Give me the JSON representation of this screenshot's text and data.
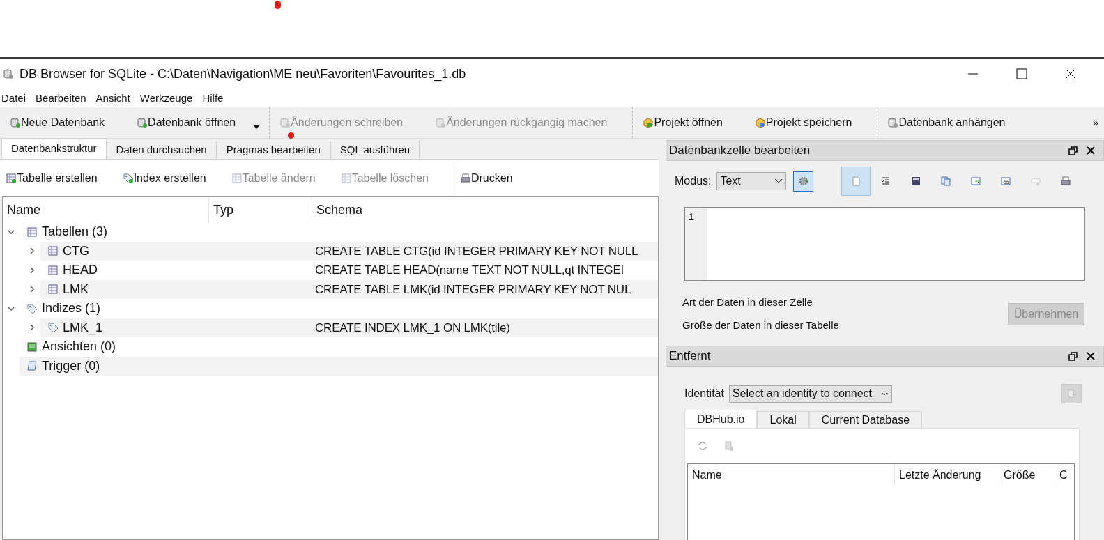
{
  "window": {
    "title": "DB Browser for SQLite - C:\\Daten\\Navigation\\ME neu\\Favoriten\\Favourites_1.db"
  },
  "menu": [
    "Datei",
    "Bearbeiten",
    "Ansicht",
    "Werkzeuge",
    "Hilfe"
  ],
  "toolbar": {
    "groups": [
      [
        {
          "label": "Neue Datenbank",
          "kind": "db-new",
          "disabled": false
        },
        {
          "label": "Datenbank öffnen",
          "kind": "db-open",
          "disabled": false,
          "dropdown": true
        }
      ],
      [
        {
          "label": "Änderungen schreiben",
          "kind": "db-save",
          "disabled": true
        },
        {
          "label": "Änderungen rückgängig machen",
          "kind": "db-undo",
          "disabled": true
        }
      ],
      [
        {
          "label": "Projekt öffnen",
          "kind": "project-open",
          "disabled": false
        },
        {
          "label": "Projekt speichern",
          "kind": "project-save",
          "disabled": false
        }
      ],
      [
        {
          "label": "Datenbank anhängen",
          "kind": "db-attach",
          "disabled": false
        }
      ]
    ],
    "overflow": "»"
  },
  "tabs": [
    {
      "label": "Datenbankstruktur",
      "selected": true
    },
    {
      "label": "Daten durchsuchen",
      "selected": false
    },
    {
      "label": "Pragmas bearbeiten",
      "selected": false
    },
    {
      "label": "SQL ausführen",
      "selected": false
    }
  ],
  "structure_toolbar": [
    {
      "label": "Tabelle erstellen",
      "kind": "table-add",
      "disabled": false
    },
    {
      "label": "Index erstellen",
      "kind": "index-add",
      "disabled": false
    },
    {
      "label": "Tabelle ändern",
      "kind": "table-edit",
      "disabled": true
    },
    {
      "label": "Tabelle löschen",
      "kind": "table-delete",
      "disabled": true
    },
    {
      "label": "Drucken",
      "kind": "print",
      "disabled": false
    }
  ],
  "tree": {
    "columns": [
      "Name",
      "Typ",
      "Schema"
    ],
    "items": [
      {
        "name": "Tabellen (3)",
        "kind": "tables",
        "expanded": true,
        "children": [
          {
            "name": "CTG",
            "kind": "table",
            "expanded": false,
            "schema": "CREATE TABLE CTG(id INTEGER PRIMARY KEY NOT NULL"
          },
          {
            "name": "HEAD",
            "kind": "table",
            "expanded": false,
            "schema": "CREATE TABLE HEAD(name TEXT NOT NULL,qt INTEGEI"
          },
          {
            "name": "LMK",
            "kind": "table",
            "expanded": false,
            "schema": "CREATE TABLE LMK(id INTEGER PRIMARY KEY NOT NUL"
          }
        ]
      },
      {
        "name": "Indizes (1)",
        "kind": "index",
        "expanded": true,
        "children": [
          {
            "name": "LMK_1",
            "kind": "index",
            "expanded": false,
            "schema": "CREATE INDEX LMK_1 ON LMK(tile)"
          }
        ]
      },
      {
        "name": "Ansichten (0)",
        "kind": "view"
      },
      {
        "name": "Trigger (0)",
        "kind": "trigger"
      }
    ]
  },
  "edit_cell": {
    "title": "Datenbankzelle bearbeiten",
    "mode_label": "Modus:",
    "mode": "Text",
    "tools": [
      {
        "kind": "text",
        "selected": true
      },
      {
        "kind": "indent",
        "selected": false
      },
      {
        "kind": "save",
        "selected": false
      },
      {
        "kind": "copy",
        "selected": false
      },
      {
        "kind": "export",
        "selected": false
      },
      {
        "kind": "link",
        "selected": false
      },
      {
        "kind": "null",
        "selected": false
      },
      {
        "kind": "print",
        "selected": false
      }
    ],
    "line_number": "1",
    "type_info": "Art der Daten in dieser Zelle",
    "size_info": "Größe der Daten in dieser Tabelle",
    "apply": {
      "label": "Übernehmen",
      "disabled": true
    }
  },
  "remote": {
    "title": "Entfernt",
    "identity_label": "Identität",
    "identity": "Select an identity to connect",
    "tabs": [
      {
        "label": "DBHub.io",
        "selected": true
      },
      {
        "label": "Lokal",
        "selected": false
      },
      {
        "label": "Current Database",
        "selected": false
      }
    ],
    "columns": [
      "Name",
      "Letzte Änderung",
      "Größe",
      "C"
    ]
  }
}
